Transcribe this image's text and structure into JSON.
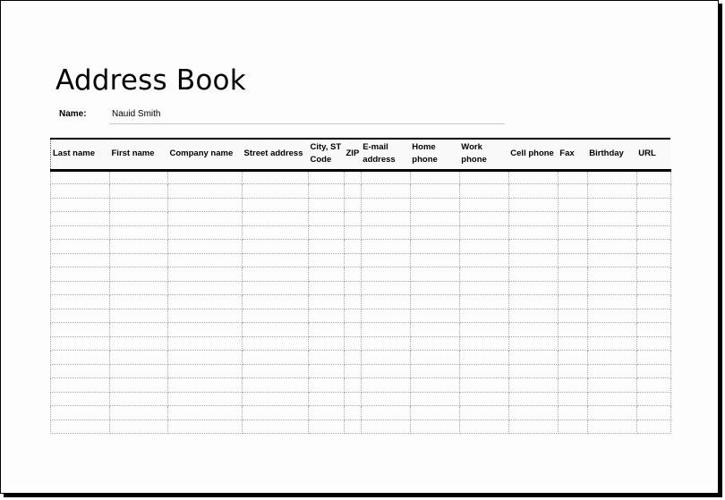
{
  "document": {
    "title": "Address Book",
    "name_label": "Name:",
    "name_value": "Nauid Smith"
  },
  "table": {
    "columns": [
      {
        "key": "last_name",
        "label": "Last name"
      },
      {
        "key": "first_name",
        "label": "First name"
      },
      {
        "key": "company_name",
        "label": "Company name"
      },
      {
        "key": "street_address",
        "label": "Street address"
      },
      {
        "key": "city_st",
        "label": "City, ST\nCode"
      },
      {
        "key": "zip",
        "label": "ZIP"
      },
      {
        "key": "email_address",
        "label": "E-mail\naddress"
      },
      {
        "key": "home_phone",
        "label": "Home\nphone"
      },
      {
        "key": "work_phone",
        "label": "Work\nphone"
      },
      {
        "key": "cell_phone",
        "label": "Cell phone"
      },
      {
        "key": "fax",
        "label": "Fax"
      },
      {
        "key": "birthday",
        "label": "Birthday"
      },
      {
        "key": "url",
        "label": "URL"
      }
    ],
    "row_count": 19,
    "rows": []
  }
}
